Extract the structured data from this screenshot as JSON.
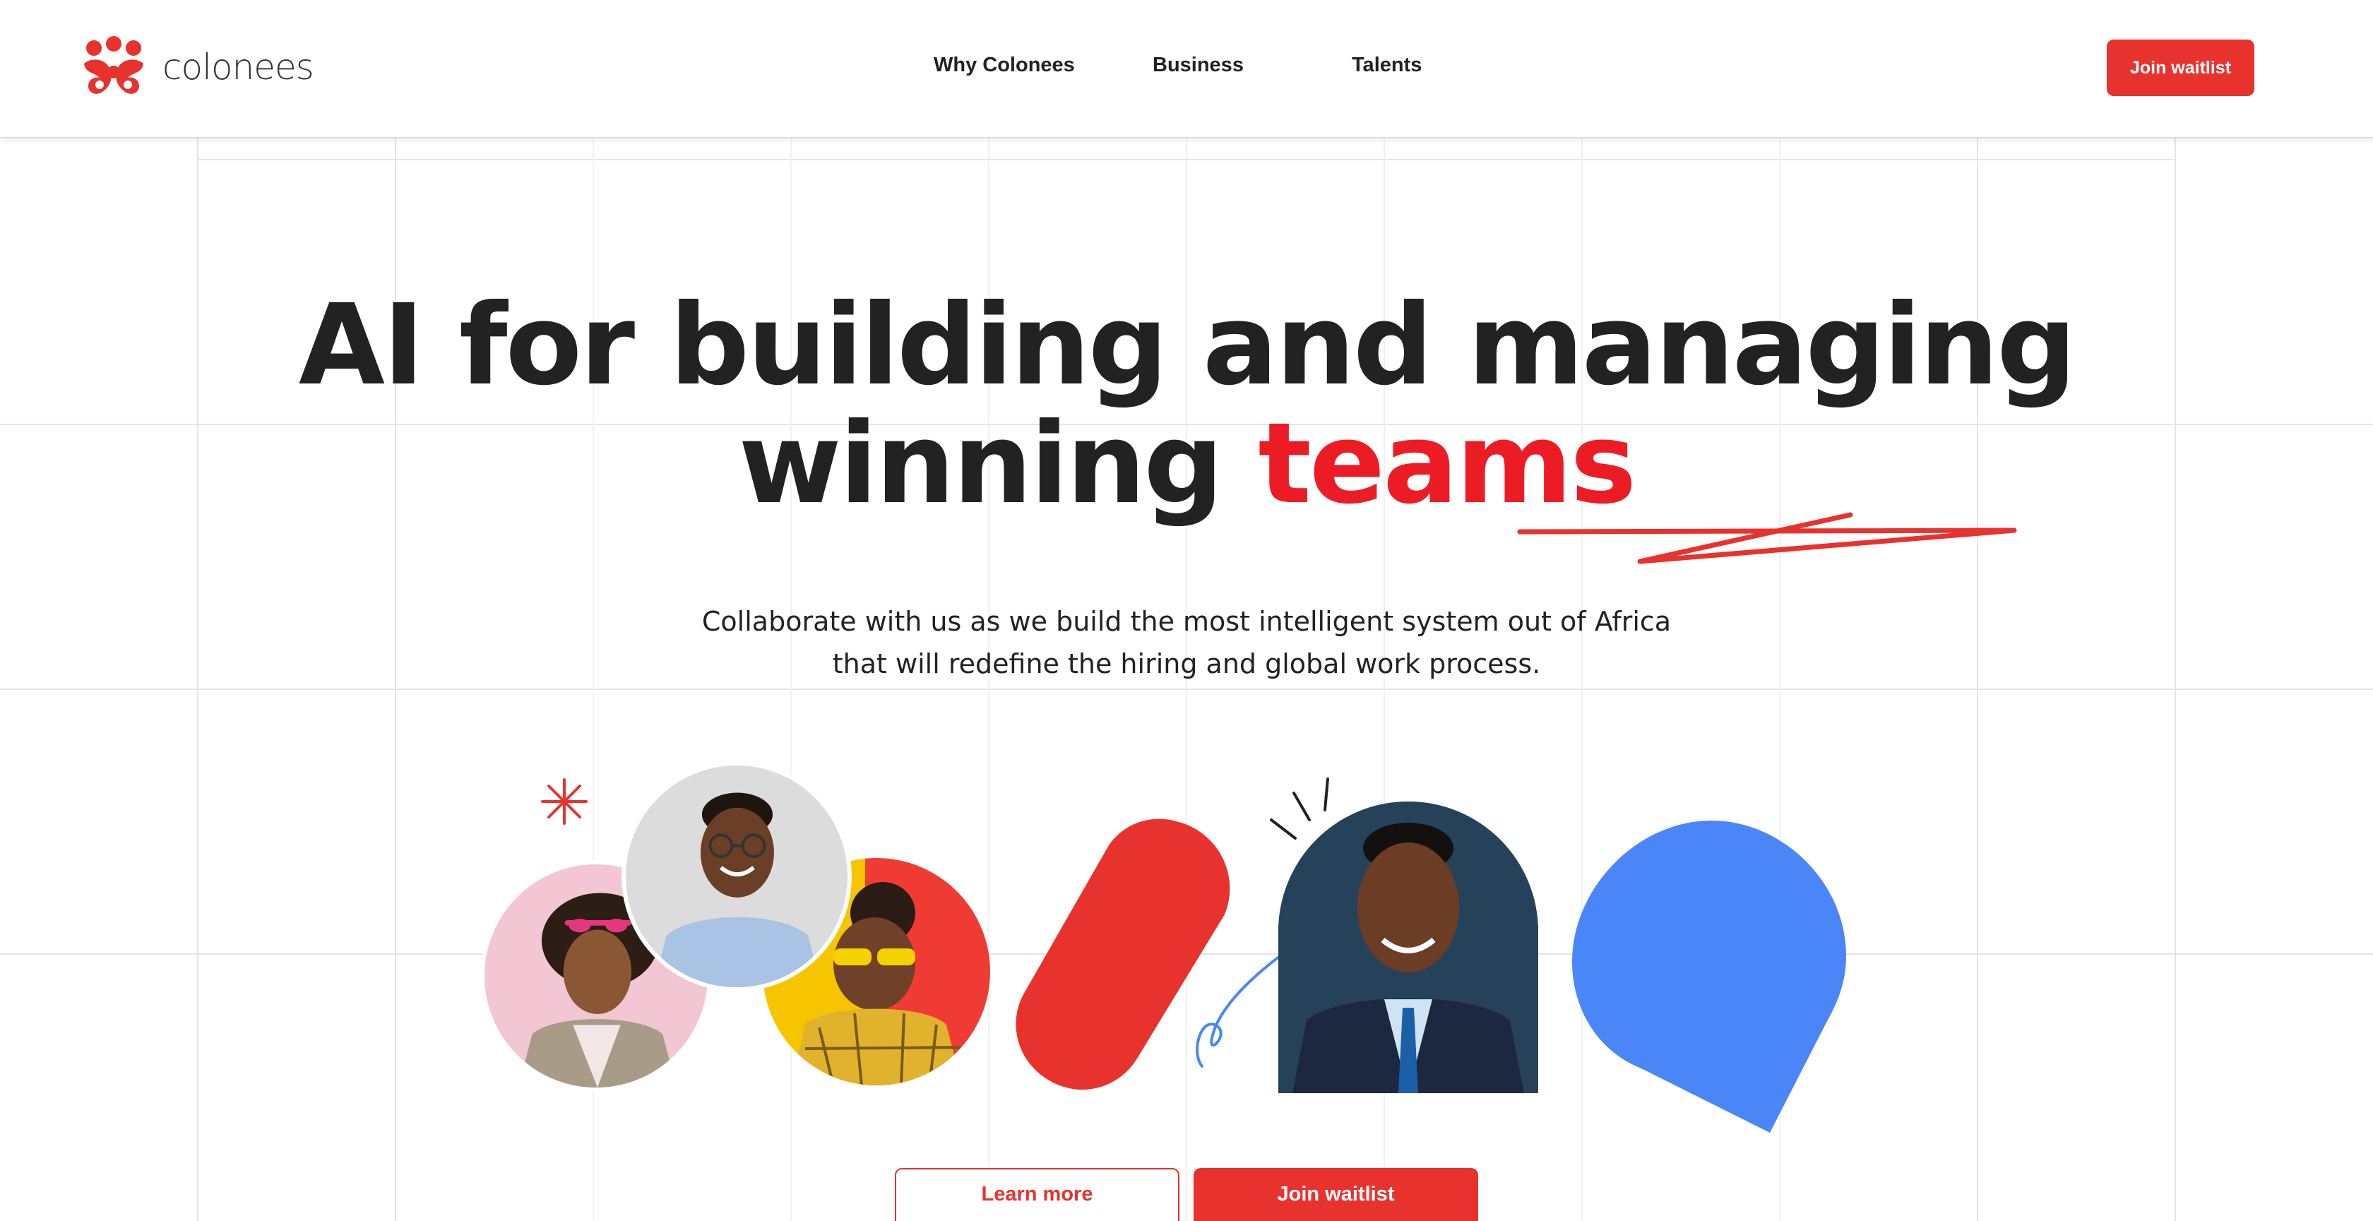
{
  "brand": {
    "name": "colonees",
    "accent_color": "#e8322d",
    "headline_accent_color": "#ec1c24",
    "blue_color": "#4a86f7",
    "logo_icon": "colonees-logo-icon"
  },
  "nav": {
    "items": [
      {
        "label": "Why Colonees"
      },
      {
        "label": "Business"
      },
      {
        "label": "Talents"
      }
    ],
    "cta_label": "Join waitlist"
  },
  "hero": {
    "title_line1": "AI for building and managing",
    "title_line2_prefix": "winning ",
    "title_line2_accent": "teams",
    "subtitle_line1": "Collaborate with us as we build the most intelligent system out of Africa",
    "subtitle_line2": "that will redefine the hiring and global work process."
  },
  "decorations": [
    "scribble-underline",
    "asterisk-icon",
    "red-pill-shape",
    "burst-lines-icon",
    "curly-arrow-icon",
    "blue-drop-shape"
  ],
  "photos": [
    "woman-pink-background-photo",
    "man-glasses-photo",
    "woman-yellow-glasses-photo",
    "man-suit-photo"
  ],
  "actions": {
    "learn_more": "Learn more",
    "join_waitlist": "Join waitlist"
  }
}
